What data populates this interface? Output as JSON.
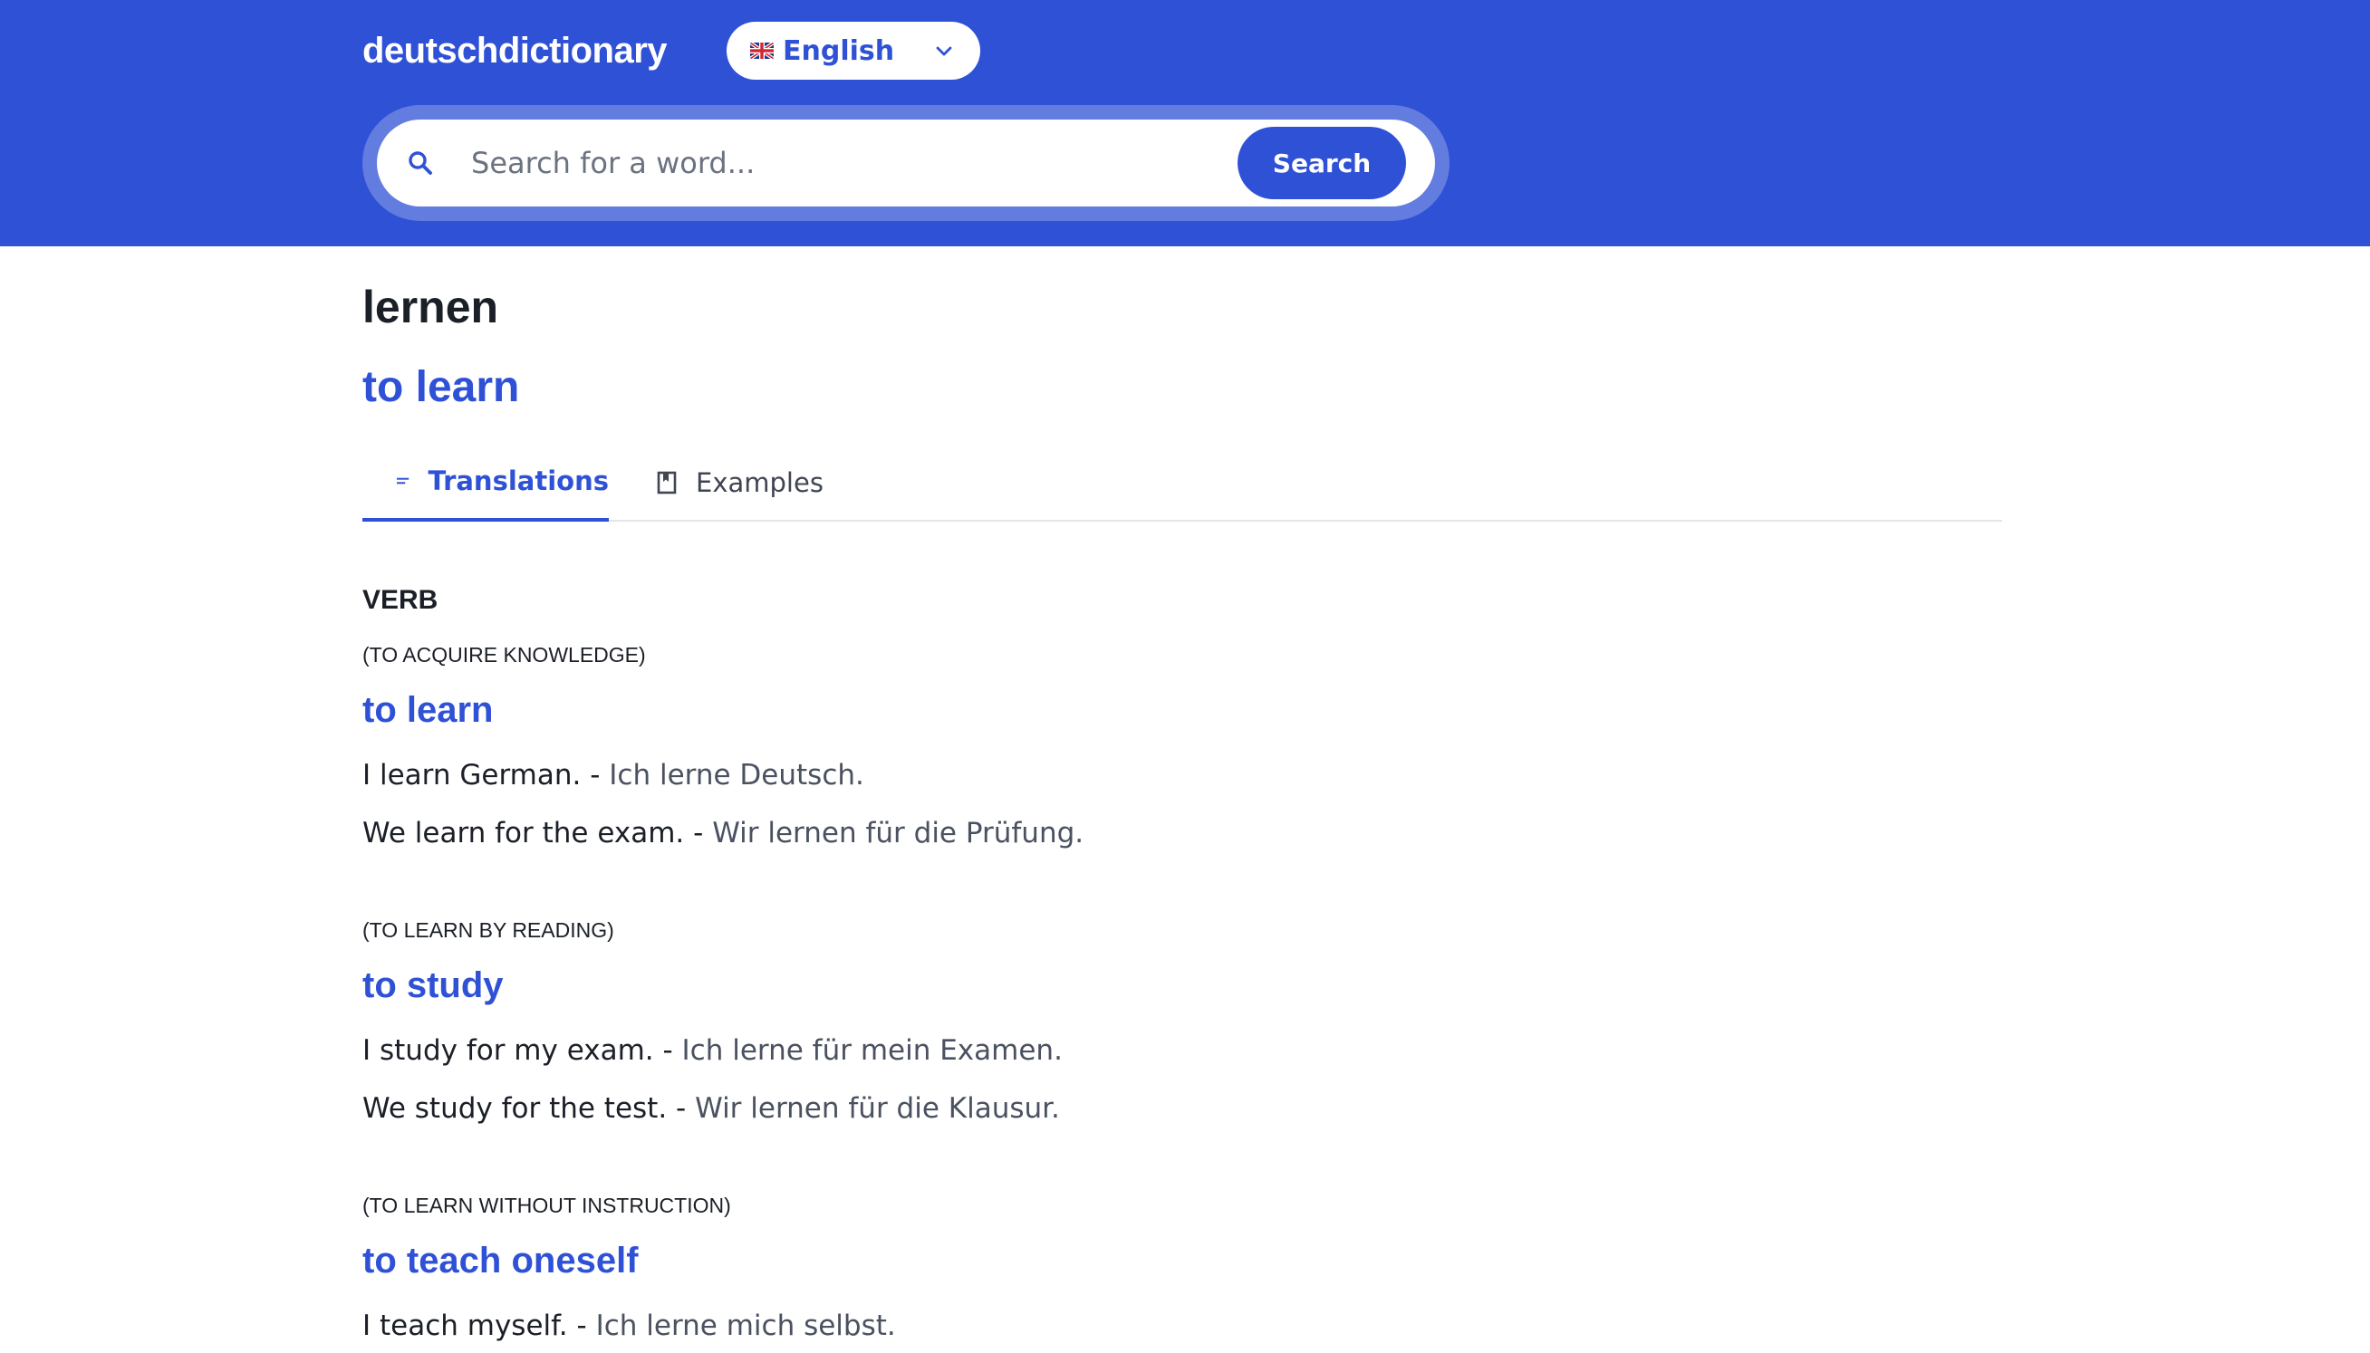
{
  "header": {
    "brand": "deutschdictionary",
    "language": {
      "selected": "English",
      "flag_icon": "uk-flag-icon"
    },
    "search": {
      "placeholder": "Search for a word...",
      "value": "",
      "button_label": "Search"
    }
  },
  "entry": {
    "word": "lernen",
    "translation": "to learn"
  },
  "tabs": [
    {
      "label": "Translations",
      "icon": "lines-icon",
      "active": true
    },
    {
      "label": "Examples",
      "icon": "book-icon",
      "active": false
    }
  ],
  "part_of_speech": "VERB",
  "senses": [
    {
      "note": "(TO ACQUIRE KNOWLEDGE)",
      "translation": "to learn",
      "examples": [
        {
          "en": "I learn German.",
          "de": "Ich lerne Deutsch."
        },
        {
          "en": "We learn for the exam.",
          "de": "Wir lernen für die Prüfung."
        }
      ]
    },
    {
      "note": "(TO LEARN BY READING)",
      "translation": "to study",
      "examples": [
        {
          "en": "I study for my exam.",
          "de": "Ich lerne für mein Examen."
        },
        {
          "en": "We study for the test.",
          "de": "Wir lernen für die Klausur."
        }
      ]
    },
    {
      "note": "(TO LEARN WITHOUT INSTRUCTION)",
      "translation": "to teach oneself",
      "examples": [
        {
          "en": "I teach myself.",
          "de": "Ich lerne mich selbst."
        }
      ]
    }
  ],
  "colors": {
    "brand_blue": "#2f51d6",
    "text_dark": "#1b1f27",
    "text_muted": "#4a5160"
  }
}
